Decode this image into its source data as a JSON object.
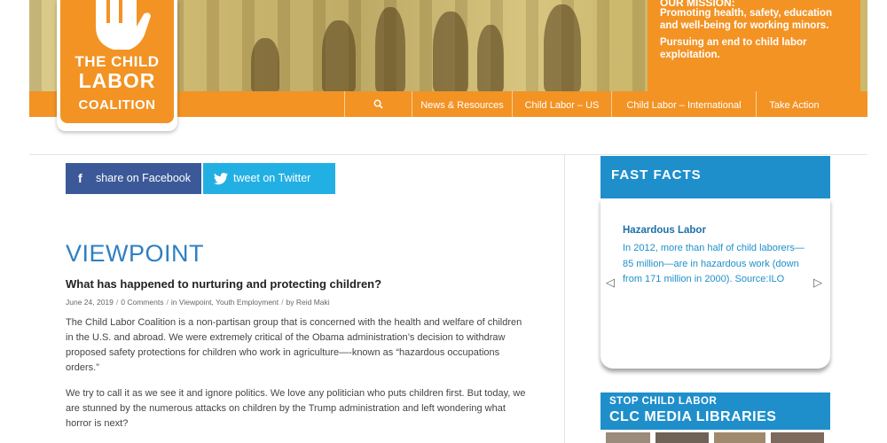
{
  "header": {
    "mission_title": "OUR MISSION:",
    "mission_line1": "Promoting health, safety, education and well-being for working minors.",
    "mission_line2": "Pursuing an end to child labor exploitation."
  },
  "logo": {
    "line1": "THE CHILD",
    "line2": "LABOR",
    "line3": "COALITION"
  },
  "nav": {
    "search_icon": "search-icon",
    "items": [
      "News & Resources",
      "Child Labor – US",
      "Child Labor – International",
      "Take Action"
    ]
  },
  "share": {
    "facebook": "share on Facebook",
    "twitter": "tweet on Twitter"
  },
  "article": {
    "section": "VIEWPOINT",
    "title": "What has happened to nurturing and protecting children?",
    "date": "June 24, 2019",
    "comments": "0 Comments",
    "in_label": "in",
    "categories": "Viewpoint, Youth Employment",
    "by_label": "by",
    "author": "Reid Maki",
    "paragraph1": "The Child Labor Coalition is a non-partisan group that is concerned with the health and welfare of children in the U.S. and abroad. We were extremely critical of the Obama administration’s decision to withdraw proposed safety protections for children who work in agriculture—-known as “hazardous occupations orders.”",
    "paragraph2": "We try to call it as we see it and ignore politics. We love any politician who puts children first. But today, we are stunned by the numerous attacks on children by the Trump administration and left wondering what horror is next?"
  },
  "sidebar": {
    "fast_facts_title": "FAST FACTS",
    "fact_title": "Hazardous Labor",
    "fact_text": "In 2012, more than half of child laborers—85 million—are in hazardous work (down from 171 million in 2000). Source:ILO",
    "media_line1": "STOP CHILD LABOR",
    "media_line2": "CLC MEDIA LIBRARIES"
  },
  "colors": {
    "orange": "#f39324",
    "blue": "#1f8fcb",
    "facebook": "#3b5998",
    "twitter": "#22b0e4"
  }
}
